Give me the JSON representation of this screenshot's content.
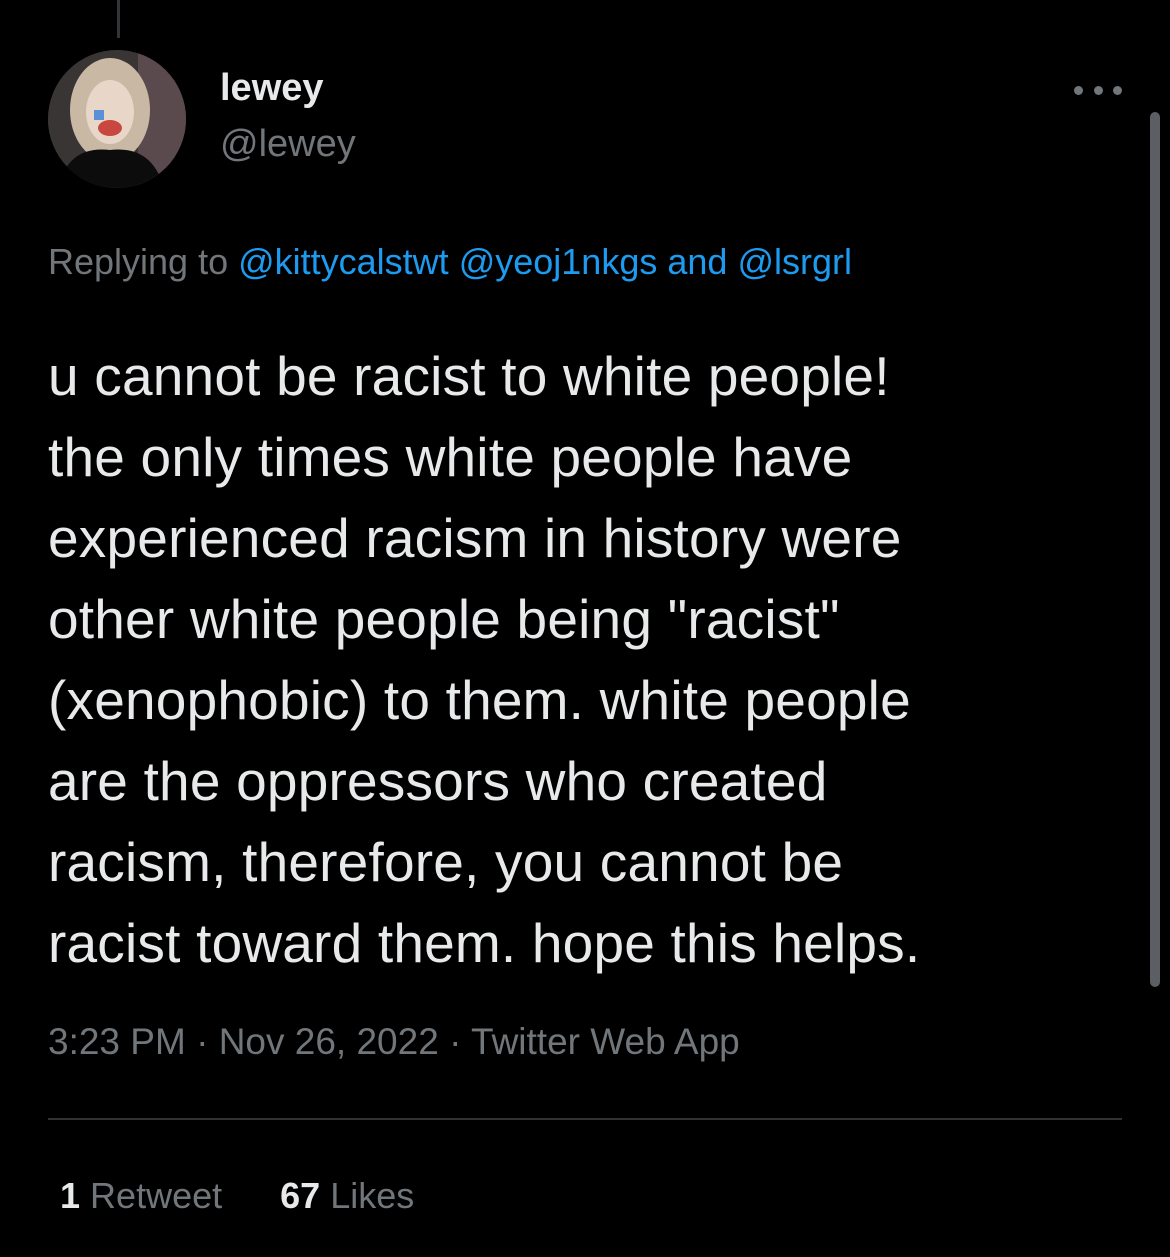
{
  "author": {
    "display_name": "lewey",
    "handle": "@lewey"
  },
  "reply": {
    "prefix": "Replying to ",
    "mentions": [
      "@kittycalstwt",
      "@yeoj1nkgs",
      "@lsrgrl"
    ],
    "joiner": " and "
  },
  "tweet": {
    "text": "u cannot be racist to white people!\nthe only times white people have\nexperienced racism in history were\nother white people being \"racist\"\n(xenophobic) to them. white people\nare the oppressors who created\nracism, therefore, you cannot be\nracist toward them. hope this helps."
  },
  "meta": {
    "time": "3:23 PM",
    "separator": " · ",
    "date": "Nov 26, 2022",
    "source": "Twitter Web App"
  },
  "stats": {
    "retweets_count": "1",
    "retweets_label": "Retweet",
    "likes_count": "67",
    "likes_label": "Likes"
  },
  "icons": {
    "more": "more-horizontal-icon"
  },
  "colors": {
    "background": "#000000",
    "text": "#e7e9ea",
    "secondary": "#71767b",
    "link": "#1d9bf0",
    "divider": "#2f3336"
  }
}
